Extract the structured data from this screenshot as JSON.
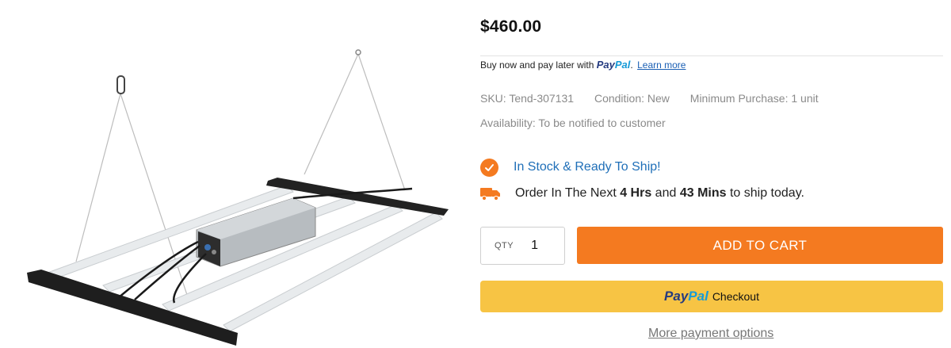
{
  "product": {
    "image_alt": "LED grow light fixture"
  },
  "pricing": {
    "price": "$460.00"
  },
  "paylater": {
    "text": "Buy now and pay later with ",
    "brand_pay": "Pay",
    "brand_pal": "Pal",
    "suffix": ".",
    "learn_more": "Learn more"
  },
  "meta": {
    "sku": "SKU: Tend-307131",
    "condition": "Condition: New",
    "minimum_purchase": "Minimum Purchase: 1 unit",
    "availability": "Availability: To be notified to customer"
  },
  "stock": {
    "text": "In Stock & Ready To Ship!",
    "icon": "check-circle-icon"
  },
  "shipping": {
    "icon": "truck-icon",
    "prefix": "Order In The Next ",
    "hours": "4 Hrs",
    "middle": " and ",
    "minutes": "43 Mins",
    "suffix": " to ship today."
  },
  "cart": {
    "qty_label": "QTY",
    "qty_value": "1",
    "add_to_cart": "ADD TO CART"
  },
  "paypal_button": {
    "brand_pay": "Pay",
    "brand_pal": "Pal",
    "label": "Checkout"
  },
  "more_payment_options": "More payment options",
  "colors": {
    "accent_orange": "#f47a20",
    "paypal_yellow": "#f7c444",
    "stock_blue": "#1f6fb8",
    "paypal_dark_blue": "#253b80",
    "paypal_light_blue": "#179bd7"
  }
}
